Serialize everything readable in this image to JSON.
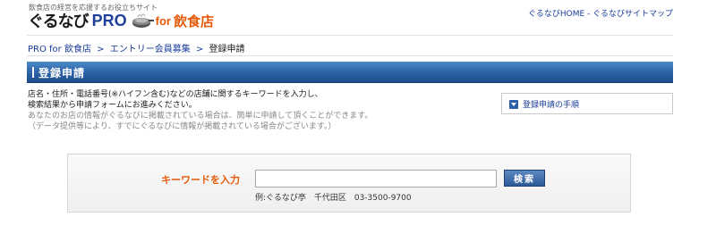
{
  "header": {
    "tagline": "飲食店の経営を応援するお役立ちサイト",
    "logo": {
      "brand": "ぐるなび",
      "pro": "PRO",
      "for": "for",
      "target": "飲食店"
    },
    "links": {
      "home": "ぐるなびHOME",
      "separator": "-",
      "sitemap": "ぐるなびサイトマップ"
    }
  },
  "breadcrumb": {
    "items": [
      "PRO for 飲食店",
      "エントリー会員募集"
    ],
    "separator": ">",
    "current": "登録申請"
  },
  "section": {
    "title": "登録申請"
  },
  "intro": {
    "line1": "店名・住所・電話番号(※ハイフン含む)などの店舗に関するキーワードを入力し、",
    "line2": "検索結果から申請フォームにお進みください。",
    "line3": "あなたのお店の情報がぐるなびに掲載されている場合は、簡単に申請して頂くことができます。",
    "line4": "（データ提供等により、すでにぐるなびに情報が掲載されている場合がございます。）"
  },
  "procedure_link": {
    "label": "登録申請の手順",
    "icon": "chevron-down-icon"
  },
  "search": {
    "label": "キーワードを入力",
    "value": "",
    "button": "検索",
    "example": "例:ぐるなび亭　千代田区　03-3500-9700"
  },
  "colors": {
    "accent_orange": "#e65a0a",
    "link_blue": "#1a3c9a",
    "titlebar_blue": "#2c63a8"
  }
}
